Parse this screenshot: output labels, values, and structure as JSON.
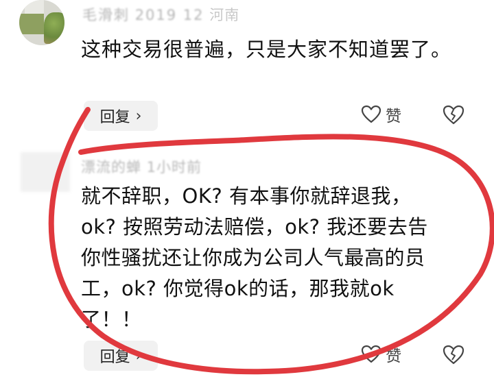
{
  "comment1": {
    "meta_visible": "毛滑刺",
    "meta_blurred": "2019 12",
    "location": "河南",
    "text": "这种交易很普遍，只是大家不知道罢了。",
    "reply_label": "回复",
    "like_label": "赞"
  },
  "comment2": {
    "meta": "漂流的蝉 1小时前",
    "lines": [
      "就不辞职，OK? 有本事你就辞退我，",
      "ok? 按照劳动法赔偿，ok? 我还要去告",
      "你性骚扰还让你成为公司人气最高的员",
      "工，ok? 你觉得ok的话，那我就ok",
      "了！！"
    ],
    "reply_label": "回复",
    "like_label": "赞"
  },
  "annotation": {
    "color": "#e0393e"
  }
}
